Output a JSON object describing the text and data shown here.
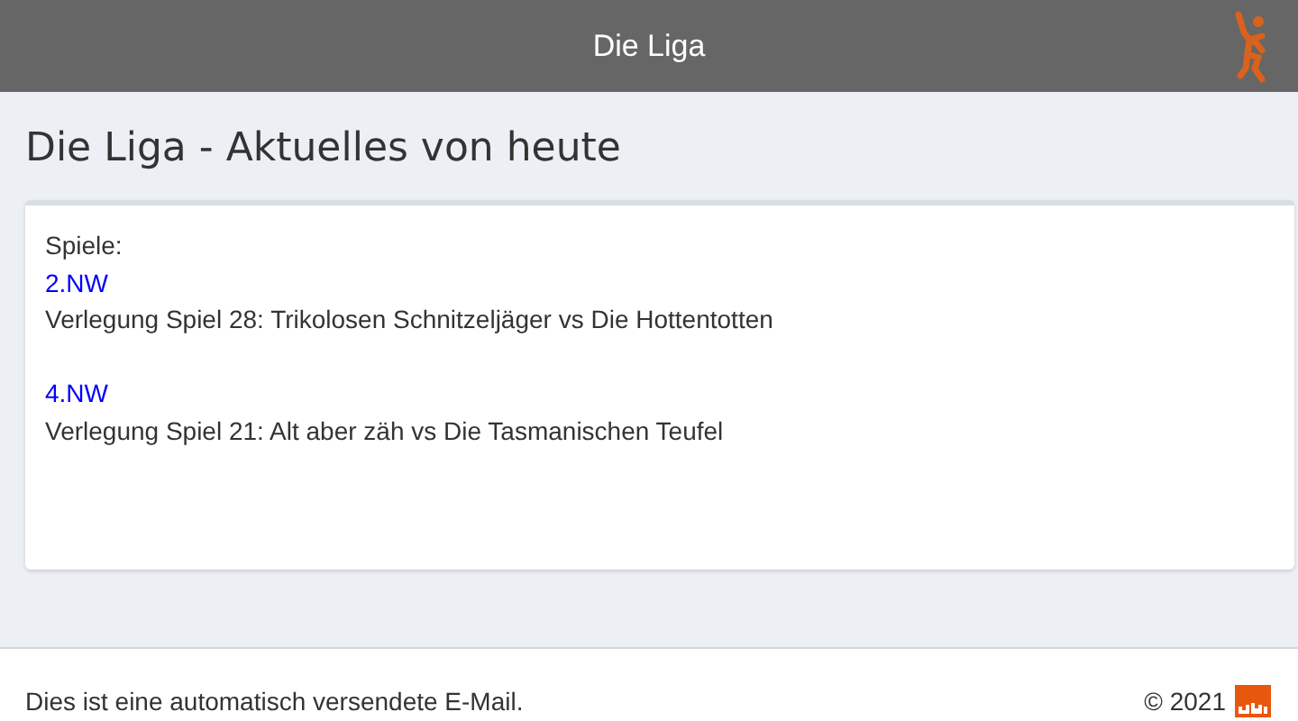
{
  "header": {
    "title": "Die Liga"
  },
  "page_title": "Die Liga - Aktuelles von heute",
  "card": {
    "label": "Spiele:",
    "games": [
      {
        "link": "2.NW",
        "text": "Verlegung Spiel 28: Trikolosen Schnitzeljäger vs Die Hottentotten"
      },
      {
        "link": "4.NW",
        "text": "Verlegung Spiel 21: Alt aber zäh vs Die Tasmanischen Teufel"
      }
    ]
  },
  "footer": {
    "note": "Dies ist eine automatisch versendete E-Mail.",
    "copyright": "© 2021"
  }
}
